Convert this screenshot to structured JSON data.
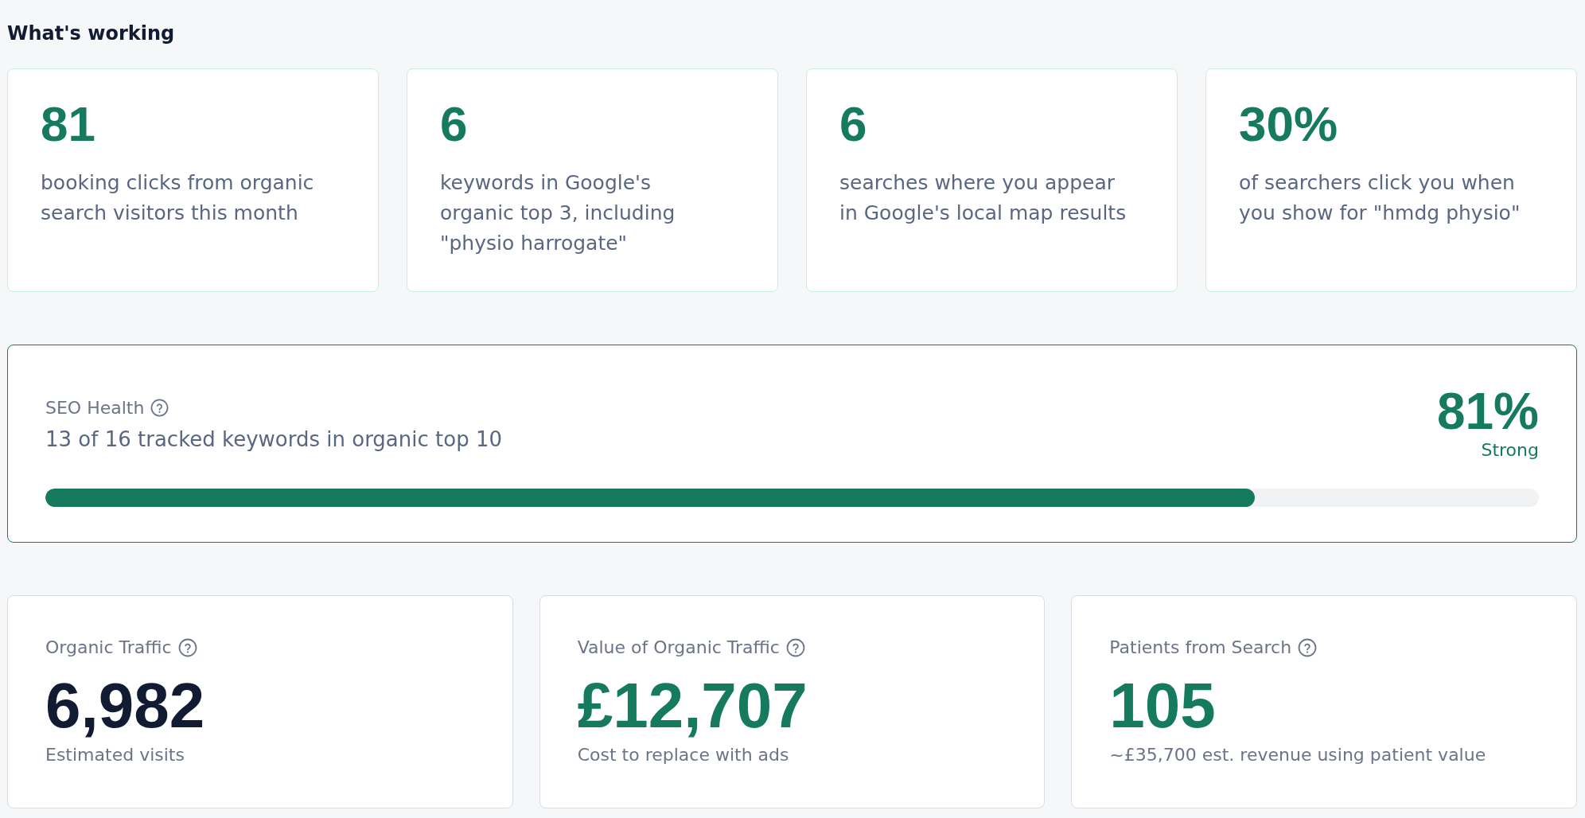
{
  "section_title": "What's working",
  "highlights": [
    {
      "value": "81",
      "description": "booking clicks from organic search visitors this month"
    },
    {
      "value": "6",
      "description": "keywords in Google's organic top 3, including \"physio harrogate\""
    },
    {
      "value": "6",
      "description": "searches where you appear in Google's local map results"
    },
    {
      "value": "30%",
      "description": "of searchers click you when you show for \"hmdg physio\""
    }
  ],
  "seo_health": {
    "label": "SEO Health",
    "summary": "13 of 16 tracked keywords in organic top 10",
    "score": "81%",
    "rating": "Strong",
    "level": 0.81
  },
  "metrics": [
    {
      "label": "Organic Traffic",
      "value": "6,982",
      "note": "Estimated visits",
      "color": "#111c33"
    },
    {
      "label": "Value of Organic Traffic",
      "value": "£12,707",
      "note": "Cost to replace with ads",
      "color": "#157a5e"
    },
    {
      "label": "Patients from Search",
      "value": "105",
      "note": "~£35,700 est. revenue using patient value",
      "color": "#157a5e"
    }
  ]
}
